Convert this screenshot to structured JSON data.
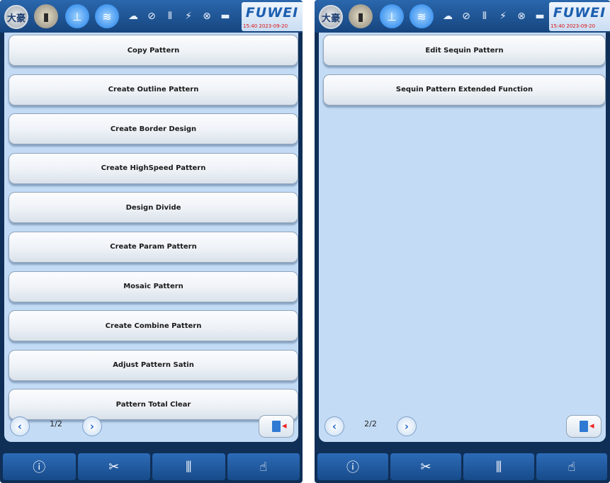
{
  "brand": "FUWEI",
  "logo_text": "大豪",
  "datetime": "15:40  2023-09-20",
  "screens": [
    {
      "menu": [
        "Copy Pattern",
        "Create Outline Pattern",
        "Create Border Design",
        "Create HighSpeed Pattern",
        "Design Divide",
        "Create Param Pattern",
        "Mosaic Pattern",
        "Create Combine Pattern",
        "Adjust Pattern Satin",
        "Pattern Total Clear"
      ],
      "page": "1/2"
    },
    {
      "menu": [
        "Edit Sequin Pattern",
        "Sequin Pattern Extended Function"
      ],
      "page": "2/2"
    }
  ],
  "glyphs": {
    "prev": "‹",
    "next": "›",
    "flashlight": "▮",
    "needle": "⊥",
    "wifi": "≋",
    "status": [
      "☁",
      "⊘",
      "⫴",
      "⚡",
      "⊗",
      "▬"
    ],
    "info": "ⓘ",
    "scissors": "✂",
    "needles": "⫼",
    "hand": "☝"
  },
  "colors": {
    "accent": "#1d7de8",
    "bar": "#174b8a",
    "content_bg": "#c3dbf5"
  }
}
